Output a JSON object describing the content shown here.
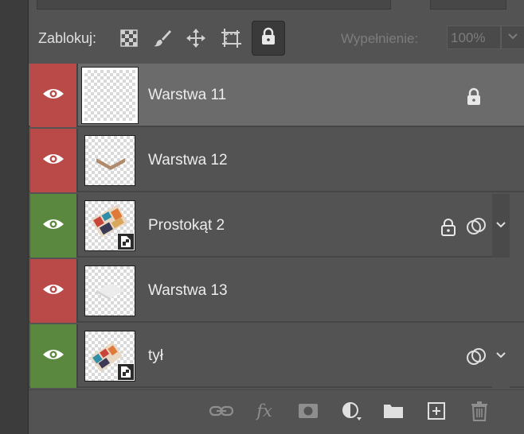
{
  "lock_bar": {
    "label": "Zablokuj:",
    "fill_label": "Wypełnienie:",
    "fill_value": "100%",
    "icons": [
      "lock-transparent-pixels-icon",
      "lock-image-pixels-icon",
      "lock-position-icon",
      "lock-artboard-icon",
      "lock-all-icon"
    ]
  },
  "layers": [
    {
      "name": "Warstwa 11",
      "visible": true,
      "color_label": "#b94a48",
      "selected": true,
      "locked": true,
      "smart_object": false,
      "has_blend_indicator": false
    },
    {
      "name": "Warstwa 12",
      "visible": true,
      "color_label": "#b94a48",
      "selected": false,
      "locked": false,
      "smart_object": false,
      "has_blend_indicator": false
    },
    {
      "name": "Prostokąt 2",
      "visible": true,
      "color_label": "#5b883f",
      "selected": false,
      "locked": true,
      "smart_object": true,
      "has_blend_indicator": true
    },
    {
      "name": "Warstwa 13",
      "visible": true,
      "color_label": "#b94a48",
      "selected": false,
      "locked": false,
      "smart_object": false,
      "has_blend_indicator": false
    },
    {
      "name": "tył",
      "visible": true,
      "color_label": "#5b883f",
      "selected": false,
      "locked": false,
      "smart_object": true,
      "has_blend_indicator": true
    }
  ],
  "bottom_bar": {
    "fx_label": "fx",
    "icons": [
      "link-layers-icon",
      "layer-style-icon",
      "add-mask-icon",
      "adjustment-layer-icon",
      "new-group-icon",
      "new-layer-icon",
      "delete-layer-icon"
    ]
  }
}
